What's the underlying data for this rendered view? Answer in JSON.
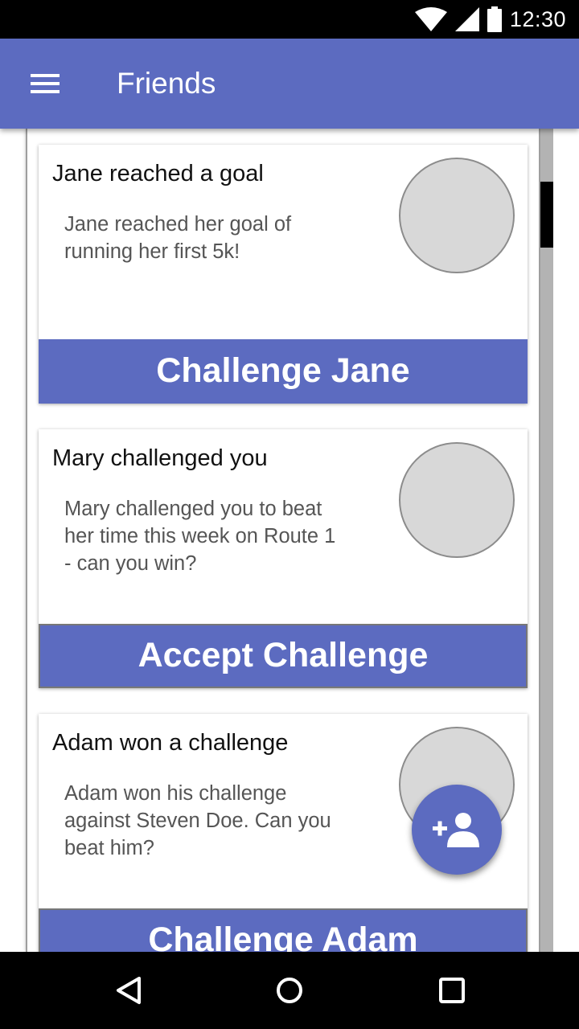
{
  "status_bar": {
    "time": "12:30",
    "icons": [
      "wifi-icon",
      "cell-signal-icon",
      "battery-icon"
    ]
  },
  "app_bar": {
    "title": "Friends",
    "menu_icon": "hamburger-menu-icon"
  },
  "colors": {
    "primary": "#5c6bc0",
    "avatar_placeholder": "#d8d8d8",
    "scroll_track": "#b3b3b3"
  },
  "cards": [
    {
      "heading": "Jane reached a goal",
      "body": "Jane reached her goal of running her first 5k!",
      "action": "Challenge Jane"
    },
    {
      "heading": "Mary challenged you",
      "body": "Mary challenged you to beat her time this week on Route 1 - can you win?",
      "action": "Accept Challenge"
    },
    {
      "heading": "Adam won a challenge",
      "body": "Adam won his challenge against Steven Doe. Can you beat him?",
      "action": "Challenge Adam"
    }
  ],
  "fab": {
    "icon": "add-person-icon"
  },
  "nav_bar": {
    "icons": [
      "back-icon",
      "home-icon",
      "recents-icon"
    ]
  }
}
